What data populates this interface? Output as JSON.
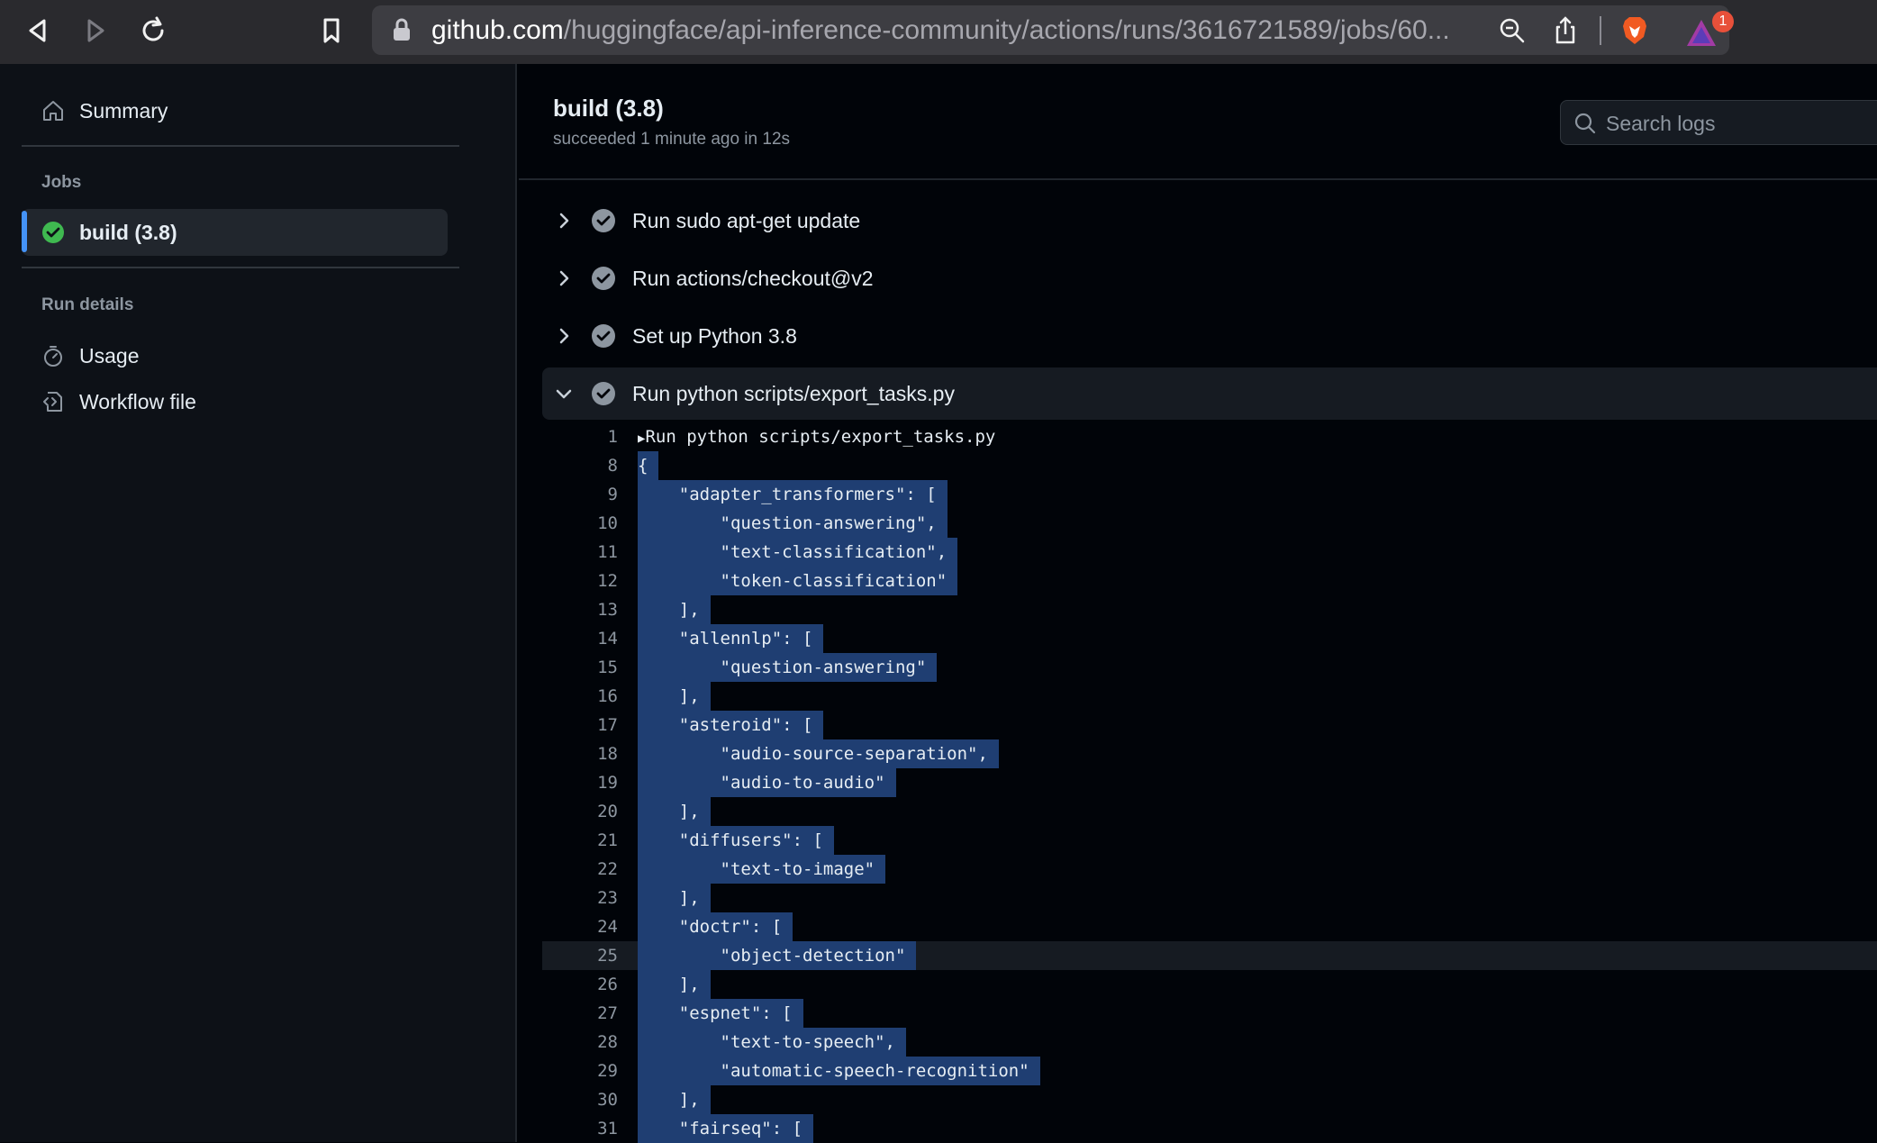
{
  "browser": {
    "url_host": "github.com",
    "url_path": "/huggingface/api-inference-community/actions/runs/3616721589/jobs/60...",
    "notification_count": "1"
  },
  "sidebar": {
    "summary_label": "Summary",
    "jobs_heading": "Jobs",
    "job_label": "build (3.8)",
    "run_details_heading": "Run details",
    "usage_label": "Usage",
    "workflow_label": "Workflow file"
  },
  "main": {
    "title": "build (3.8)",
    "subtitle": "succeeded 1 minute ago in 12s",
    "search_placeholder": "Search logs",
    "steps": [
      {
        "label": "Run sudo apt-get update",
        "expanded": false
      },
      {
        "label": "Run actions/checkout@v2",
        "expanded": false
      },
      {
        "label": "Set up Python 3.8",
        "expanded": false
      },
      {
        "label": "Run python scripts/export_tasks.py",
        "expanded": true
      }
    ],
    "log_header": "Run python scripts/export_tasks.py",
    "log_lines": [
      {
        "n": "1",
        "text": "Run python scripts/export_tasks.py"
      },
      {
        "n": "8",
        "text": "{"
      },
      {
        "n": "9",
        "text": "    \"adapter_transformers\": ["
      },
      {
        "n": "10",
        "text": "        \"question-answering\","
      },
      {
        "n": "11",
        "text": "        \"text-classification\","
      },
      {
        "n": "12",
        "text": "        \"token-classification\""
      },
      {
        "n": "13",
        "text": "    ],"
      },
      {
        "n": "14",
        "text": "    \"allennlp\": ["
      },
      {
        "n": "15",
        "text": "        \"question-answering\""
      },
      {
        "n": "16",
        "text": "    ],"
      },
      {
        "n": "17",
        "text": "    \"asteroid\": ["
      },
      {
        "n": "18",
        "text": "        \"audio-source-separation\","
      },
      {
        "n": "19",
        "text": "        \"audio-to-audio\""
      },
      {
        "n": "20",
        "text": "    ],"
      },
      {
        "n": "21",
        "text": "    \"diffusers\": ["
      },
      {
        "n": "22",
        "text": "        \"text-to-image\""
      },
      {
        "n": "23",
        "text": "    ],"
      },
      {
        "n": "24",
        "text": "    \"doctr\": ["
      },
      {
        "n": "25",
        "text": "        \"object-detection\""
      },
      {
        "n": "26",
        "text": "    ],"
      },
      {
        "n": "27",
        "text": "    \"espnet\": ["
      },
      {
        "n": "28",
        "text": "        \"text-to-speech\","
      },
      {
        "n": "29",
        "text": "        \"automatic-speech-recognition\""
      },
      {
        "n": "30",
        "text": "    ],"
      },
      {
        "n": "31",
        "text": "    \"fairseq\": ["
      }
    ]
  },
  "colors": {
    "success": "#3fb950",
    "selection": "#1f3e72",
    "accent": "#4493f8"
  }
}
